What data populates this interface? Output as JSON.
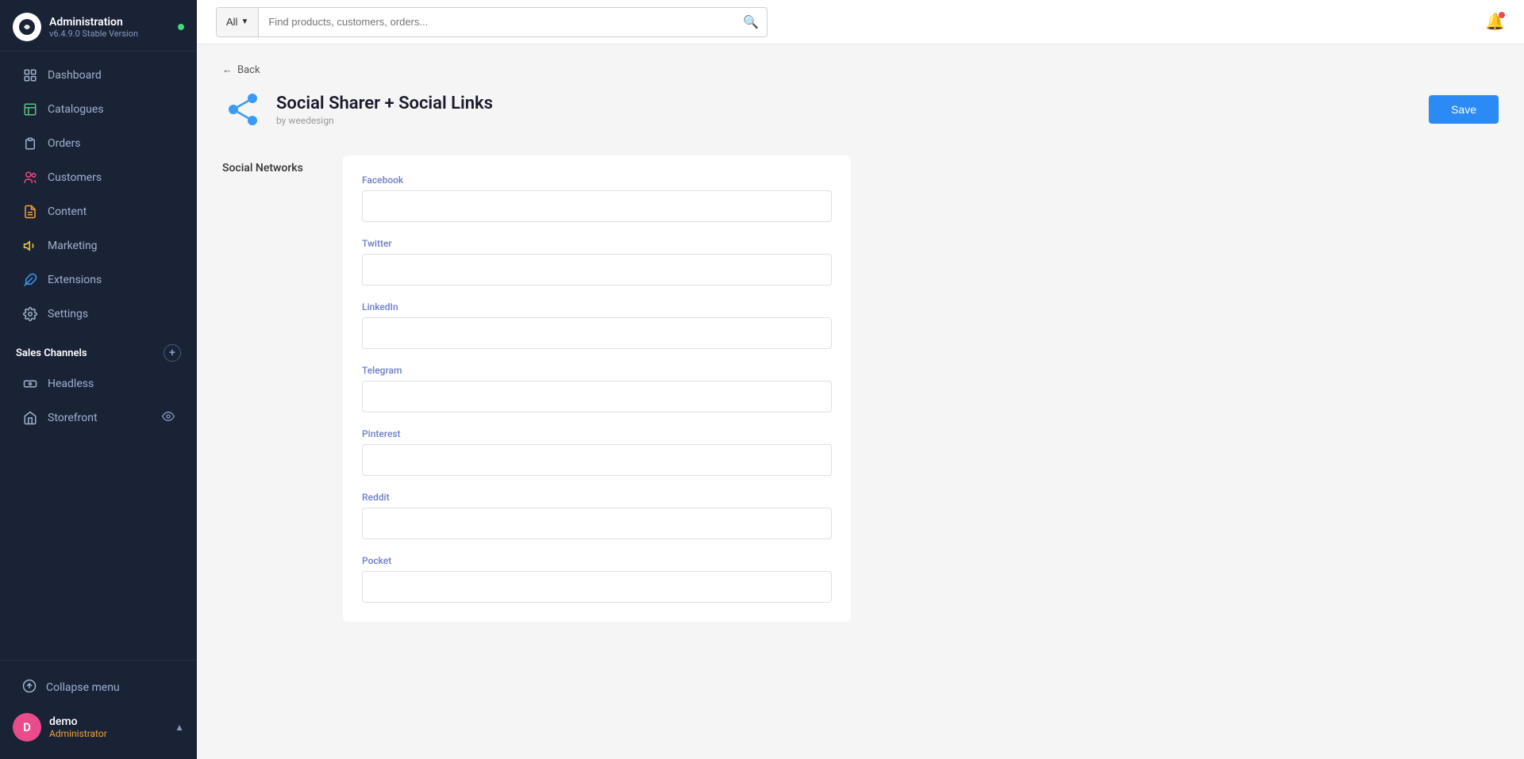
{
  "app": {
    "name": "Administration",
    "version": "v6.4.9.0 Stable Version"
  },
  "nav": {
    "items": [
      {
        "id": "dashboard",
        "label": "Dashboard",
        "icon": "dashboard-icon"
      },
      {
        "id": "catalogues",
        "label": "Catalogues",
        "icon": "catalogues-icon"
      },
      {
        "id": "orders",
        "label": "Orders",
        "icon": "orders-icon"
      },
      {
        "id": "customers",
        "label": "Customers",
        "icon": "customers-icon"
      },
      {
        "id": "content",
        "label": "Content",
        "icon": "content-icon"
      },
      {
        "id": "marketing",
        "label": "Marketing",
        "icon": "marketing-icon"
      },
      {
        "id": "extensions",
        "label": "Extensions",
        "icon": "extensions-icon"
      },
      {
        "id": "settings",
        "label": "Settings",
        "icon": "settings-icon"
      }
    ],
    "sales_channels_label": "Sales Channels",
    "channels": [
      {
        "id": "headless",
        "label": "Headless",
        "icon": "headless-icon"
      },
      {
        "id": "storefront",
        "label": "Storefront",
        "icon": "storefront-icon"
      }
    ],
    "collapse_label": "Collapse menu"
  },
  "user": {
    "initials": "D",
    "name": "demo",
    "role": "Administrator"
  },
  "topbar": {
    "search_filter": "All",
    "search_placeholder": "Find products, customers, orders..."
  },
  "back_label": "Back",
  "plugin": {
    "title": "Social Sharer + Social Links",
    "subtitle": "by weedesign"
  },
  "save_label": "Save",
  "form": {
    "section_label": "Social Networks",
    "fields": [
      {
        "id": "facebook",
        "label": "Facebook",
        "value": ""
      },
      {
        "id": "twitter",
        "label": "Twitter",
        "value": ""
      },
      {
        "id": "linkedin",
        "label": "LinkedIn",
        "value": ""
      },
      {
        "id": "telegram",
        "label": "Telegram",
        "value": ""
      },
      {
        "id": "pinterest",
        "label": "Pinterest",
        "value": ""
      },
      {
        "id": "reddit",
        "label": "Reddit",
        "value": ""
      },
      {
        "id": "pocket",
        "label": "Pocket",
        "value": ""
      }
    ]
  }
}
